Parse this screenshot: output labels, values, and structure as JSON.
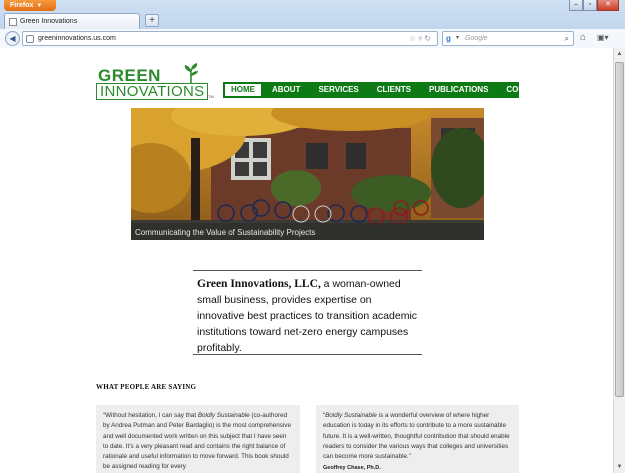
{
  "browser": {
    "menu_label": "Firefox",
    "tab_title": "Green Innovations",
    "new_tab": "+",
    "url": "greeninnovations.us.com",
    "search_placeholder": "Google",
    "search_engine_icon": "google-icon"
  },
  "site": {
    "logo": {
      "line1": "GREEN",
      "line2": "INNOVATIONS",
      "tm": "TM"
    },
    "nav": [
      "HOME",
      "ABOUT",
      "SERVICES",
      "CLIENTS",
      "PUBLICATIONS",
      "CONTACT"
    ],
    "active_nav": "HOME",
    "hero_caption": "Communicating the Value of Sustainability Projects",
    "intro": {
      "company": "Green Innovations, LLC,",
      "text": " a woman-owned small business, provides expertise on innovative best practices to transition academic institutions toward net-zero energy campuses profitably."
    },
    "testimonials_heading": "WHAT PEOPLE ARE SAYING",
    "testimonials": [
      {
        "quote_pre": "“Without hesitation, I can say that ",
        "quote_title": "Boldly Sustainable",
        "quote_post": " (co-authored by Andrea Putman and Peter Bardaglio) is the most comprehensive and well documented work written on this subject that I have seen to date. It’s a very pleasant read and contains the right balance of rationale and useful information to move forward. This book should be assigned reading for every",
        "author": ""
      },
      {
        "quote_pre": "“",
        "quote_title": "Boldly Sustainable",
        "quote_post": " is a wonderful overview of where higher education is today in its efforts to contribute to a more sustainable future. It is a well-written, thoughtful contribution that should enable readers to consider the various ways that colleges and universities can become more sustainable.”",
        "author": "Geoffrey Chase, Ph.D."
      }
    ]
  },
  "colors": {
    "brand_green": "#0e7a15",
    "logo_green": "#2b8a2b",
    "quote_bg": "#eeeeee"
  }
}
